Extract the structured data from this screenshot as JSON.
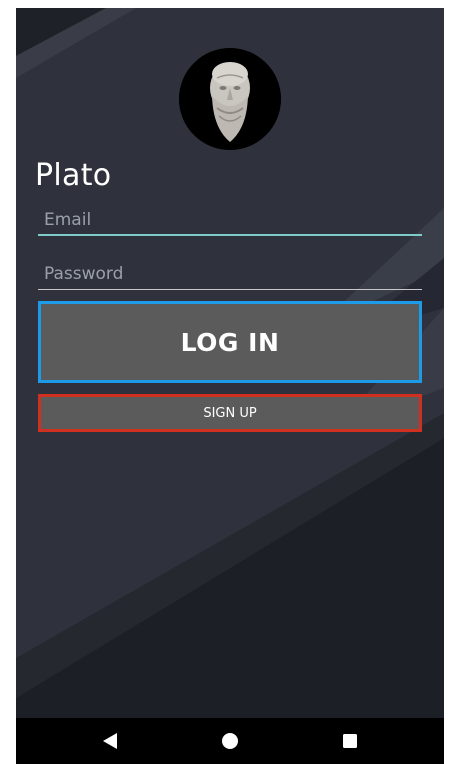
{
  "app": {
    "title": "Plato"
  },
  "form": {
    "email_placeholder": "Email",
    "email_value": "",
    "password_placeholder": "Password",
    "password_value": ""
  },
  "buttons": {
    "login_label": "LOG IN",
    "signup_label": "SIGN UP"
  },
  "navbar": {
    "back_icon": "back-triangle-icon",
    "home_icon": "home-circle-icon",
    "recent_icon": "recent-square-icon"
  },
  "colors": {
    "background": "#2b2e38",
    "button_fill": "#5b5b5b",
    "login_border": "#1e9be8",
    "signup_border": "#d0301f",
    "email_underline": "#7ecbc9"
  }
}
